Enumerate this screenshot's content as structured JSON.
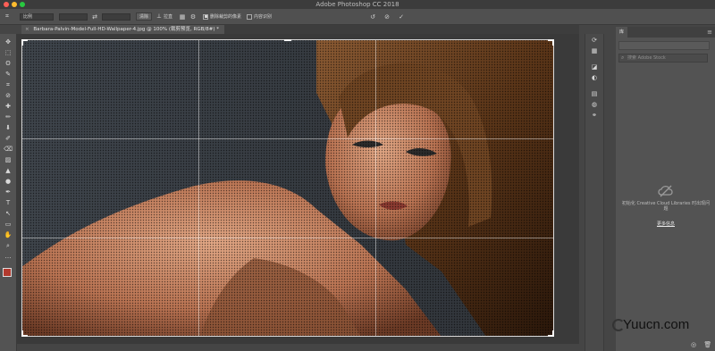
{
  "window": {
    "title": "Adobe Photoshop CC 2018",
    "traffic_colors": [
      "#ff5f57",
      "#febc2e",
      "#28c840"
    ]
  },
  "options_bar": {
    "ratio_select": "比例",
    "swap_icon": "swap-icon",
    "clear_label": "清除",
    "straighten_label": "拉直",
    "delete_cropped_label": "删除裁剪的像素",
    "delete_cropped_checked": true,
    "content_aware_label": "内容识别",
    "content_aware_checked": false,
    "reset_icon": "↺",
    "cancel_icon": "⊘",
    "commit_icon": "✓"
  },
  "document": {
    "tab_label": "Barbara-Palvin-Model-Full-HD-Wallpaper-4.jpg @ 100% (裁剪预览, RGB/8#) *",
    "close_glyph": "×"
  },
  "tools": [
    "✥",
    "⬚",
    "ʘ",
    "✎",
    "⌗",
    "⊘",
    "✚",
    "✏",
    "⬇",
    "✐",
    "⌫",
    "▨",
    "▲",
    "●",
    "✒",
    "T",
    "↖",
    "▭",
    "✋",
    "⌕",
    "…"
  ],
  "libraries_panel": {
    "tab_label": "库",
    "menu_glyph": "≡",
    "search_placeholder": "搜索 Adobe Stock",
    "message": "初始化 Creative Cloud Libraries 时出现问题",
    "more_info_link": "更多信息"
  },
  "watermark": "Yuucn.com",
  "colors": {
    "accent_foreground": "#b23a2e",
    "background_swatch": "#ffffff"
  }
}
